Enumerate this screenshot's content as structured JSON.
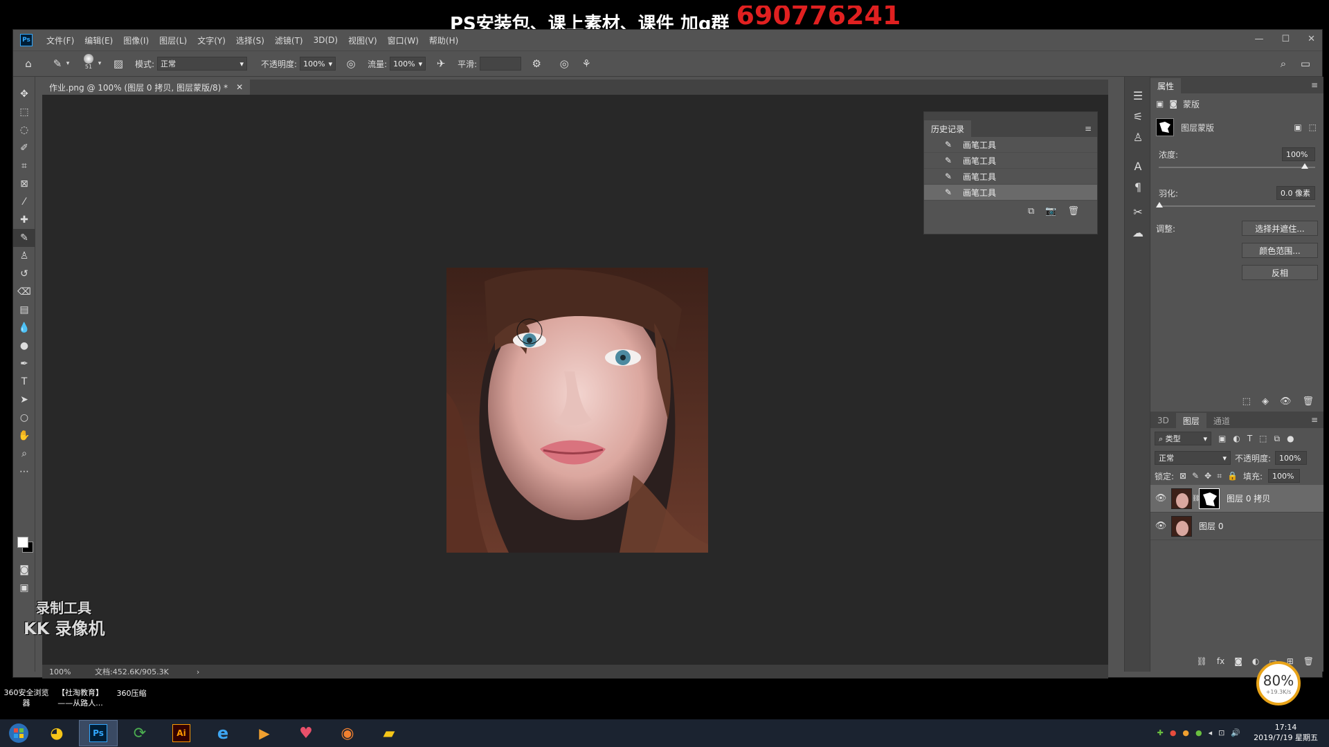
{
  "banner": {
    "text": "PS安装包、课上素材、课件 加q群",
    "number": "690776241"
  },
  "app": {
    "logo": "Ps",
    "menu": [
      "文件(F)",
      "编辑(E)",
      "图像(I)",
      "图层(L)",
      "文字(Y)",
      "选择(S)",
      "滤镜(T)",
      "3D(D)",
      "视图(V)",
      "窗口(W)",
      "帮助(H)"
    ]
  },
  "options": {
    "brush_size": "51",
    "mode_label": "模式:",
    "mode_value": "正常",
    "opacity_label": "不透明度:",
    "opacity_value": "100%",
    "flow_label": "流量:",
    "flow_value": "100%",
    "smooth_label": "平滑:",
    "smooth_value": ""
  },
  "document": {
    "tab_title": "作业.png @ 100% (图层 0 拷贝, 图层蒙版/8) *",
    "zoom": "100%",
    "doc_info": "文档:452.6K/905.3K"
  },
  "history": {
    "title": "历史记录",
    "items": [
      {
        "label": "画笔工具"
      },
      {
        "label": "画笔工具"
      },
      {
        "label": "画笔工具"
      },
      {
        "label": "画笔工具"
      }
    ]
  },
  "properties": {
    "tab": "属性",
    "mask_label": "蒙版",
    "layer_mask_label": "图层蒙版",
    "density_label": "浓度:",
    "density_value": "100%",
    "feather_label": "羽化:",
    "feather_value": "0.0 像素",
    "adjust_label": "调整:",
    "btn_select_mask": "选择并遮住...",
    "btn_color_range": "颜色范围...",
    "btn_invert": "反相"
  },
  "layers": {
    "tabs": [
      "3D",
      "图层",
      "通道"
    ],
    "filter_kind": "类型",
    "blend_mode": "正常",
    "opacity_label": "不透明度:",
    "opacity_value": "100%",
    "lock_label": "锁定:",
    "fill_label": "填充:",
    "fill_value": "100%",
    "items": [
      {
        "name": "图层 0 拷贝"
      },
      {
        "name": "图层 0"
      }
    ]
  },
  "watermark": {
    "line1": "录制工具",
    "line2": "KK 录像机"
  },
  "desktop": {
    "icons": [
      "360安全浏览器",
      "【社淘教育】——从路人...",
      "360压缩"
    ]
  },
  "net_widget": {
    "percent": "80%",
    "speed": "+19.3K/s"
  },
  "clock": {
    "time": "17:14",
    "date": "2019/7/19 星期五"
  }
}
